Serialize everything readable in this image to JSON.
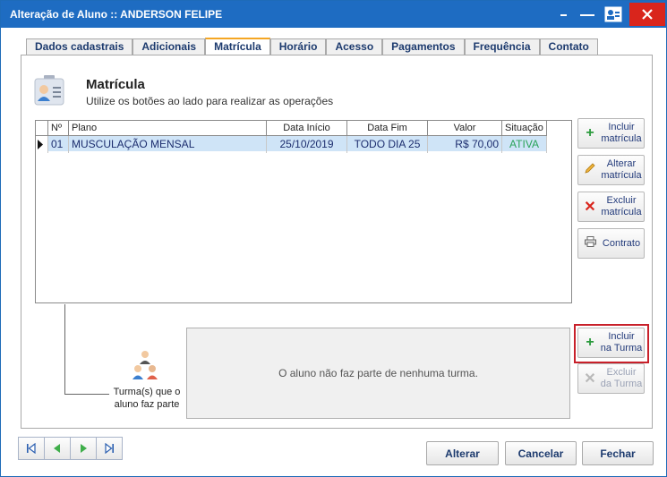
{
  "window": {
    "title": "Alteração de Aluno :: ANDERSON FELIPE"
  },
  "tabs": [
    {
      "label": "Dados cadastrais"
    },
    {
      "label": "Adicionais"
    },
    {
      "label": "Matrícula"
    },
    {
      "label": "Horário"
    },
    {
      "label": "Acesso"
    },
    {
      "label": "Pagamentos"
    },
    {
      "label": "Frequência"
    },
    {
      "label": "Contato"
    }
  ],
  "active_tab": "Matrícula",
  "header": {
    "title": "Matrícula",
    "subtitle": "Utilize os botões ao lado para realizar as operações"
  },
  "grid": {
    "columns": [
      "Nº",
      "Plano",
      "Data Início",
      "Data Fim",
      "Valor",
      "Situação"
    ],
    "rows": [
      [
        "01",
        "MUSCULAÇÃO MENSAL",
        "25/10/2019",
        "TODO DIA 25",
        "R$ 70,00",
        "ATIVA"
      ]
    ]
  },
  "side_buttons": {
    "incluir_matricula": "Incluir\nmatrícula",
    "alterar_matricula": "Alterar\nmatrícula",
    "excluir_matricula": "Excluir\nmatrícula",
    "contrato": "Contrato",
    "incluir_turma": "Incluir\nna Turma",
    "excluir_turma": "Excluir\nda Turma"
  },
  "turma": {
    "label": "Turma(s) que o aluno faz parte",
    "empty_message": "O aluno não faz parte de nenhuma turma."
  },
  "bottom_buttons": {
    "alterar": "Alterar",
    "cancelar": "Cancelar",
    "fechar": "Fechar"
  },
  "colors": {
    "titlebar": "#1e6cc2",
    "close": "#d9251c",
    "active_tab_accent": "#f5a623",
    "row_selected": "#cfe4f7",
    "status_active": "#2aa35a",
    "highlight": "#c8202a"
  }
}
